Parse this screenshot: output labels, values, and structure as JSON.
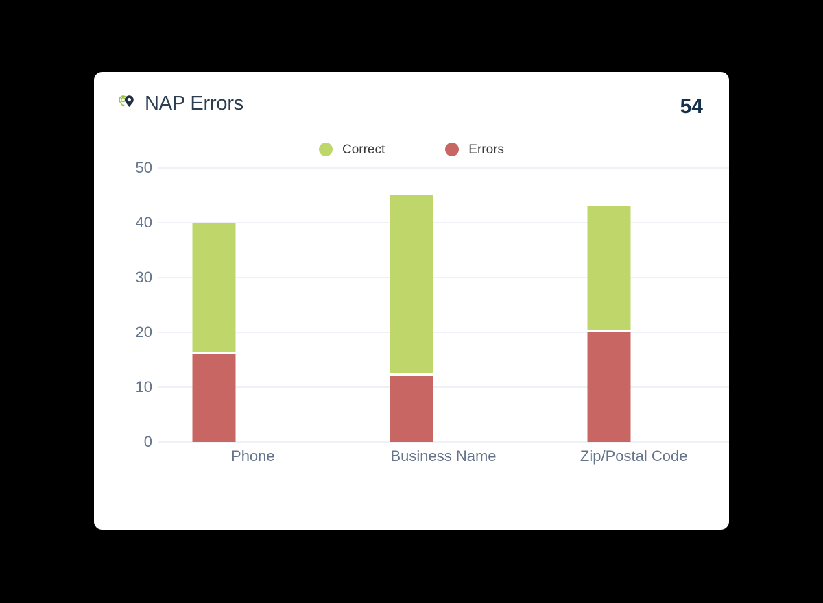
{
  "card": {
    "title": "NAP Errors",
    "total": "54",
    "icon": "map-pin-duo-icon",
    "background": "#ffffff"
  },
  "legend": {
    "position": "top-center",
    "items": [
      {
        "label": "Correct",
        "color": "#bfd76a",
        "swatch": "circle"
      },
      {
        "label": "Errors",
        "color": "#c76663",
        "swatch": "circle"
      }
    ]
  },
  "axis": {
    "y_ticks": [
      "50",
      "40",
      "30",
      "20",
      "10",
      "0"
    ],
    "tick_color": "#64748b",
    "gridline_color": "#eef1f5"
  },
  "chart_data": {
    "type": "bar",
    "stacked": true,
    "title": "NAP Errors",
    "xlabel": "",
    "ylabel": "",
    "ylim": [
      0,
      50
    ],
    "ytick_step": 10,
    "grid": true,
    "legend_position": "top-center",
    "categories": [
      "Phone",
      "Business Name",
      "Zip/Postal Code"
    ],
    "series": [
      {
        "name": "Errors",
        "color": "#c76663",
        "values": [
          16.5,
          12.5,
          20.5
        ]
      },
      {
        "name": "Correct",
        "color": "#bfd76a",
        "values": [
          23.5,
          32.5,
          22.5
        ]
      }
    ],
    "totals": [
      40,
      45,
      43
    ],
    "annotations": [
      {
        "name": "total-value",
        "text": "54"
      }
    ]
  },
  "colors": {
    "page_background": "#000000",
    "title_text": "#2c3e50",
    "total_text": "#14314f",
    "correct": "#bfd76a",
    "errors": "#c76663",
    "icon_green": "#9bc04c",
    "icon_navy": "#1f3044"
  }
}
